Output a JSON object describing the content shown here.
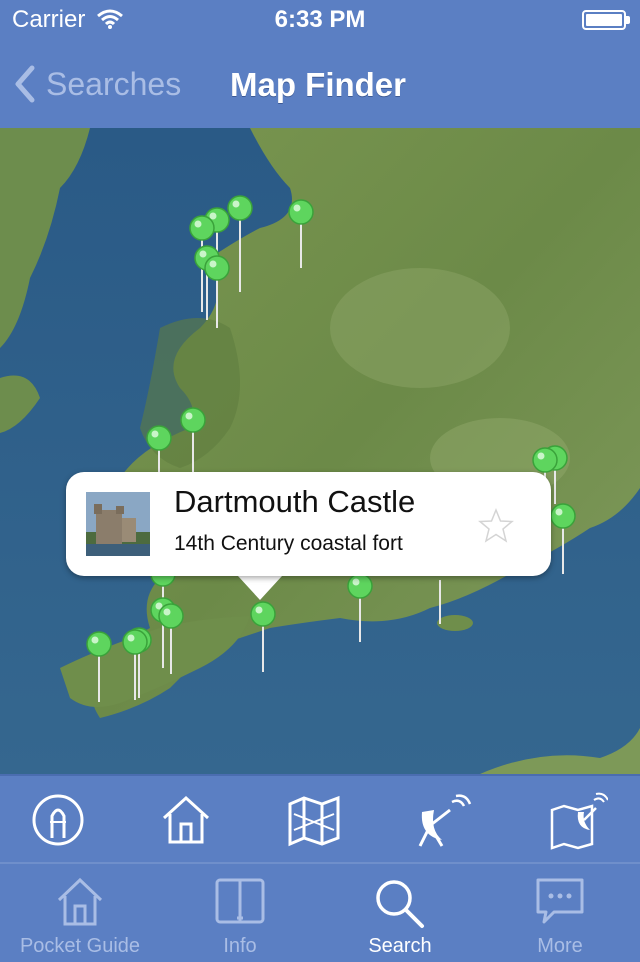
{
  "status_bar": {
    "carrier": "Carrier",
    "time": "6:33 PM"
  },
  "nav": {
    "back_label": "Searches",
    "title": "Map Finder"
  },
  "callout": {
    "title": "Dartmouth Castle",
    "subtitle": "14th Century coastal fort"
  },
  "toolbar": {
    "icons": [
      "lighthouse-icon",
      "house-icon",
      "map-icon",
      "satellite-dish-icon",
      "map-satellite-icon"
    ]
  },
  "tabs": [
    {
      "label": "Pocket Guide",
      "icon": "house-icon"
    },
    {
      "label": "Info",
      "icon": "book-icon"
    },
    {
      "label": "Search",
      "icon": "search-icon"
    },
    {
      "label": "More",
      "icon": "chat-bubble-icon"
    }
  ],
  "colors": {
    "bar": "#5b7fc3",
    "pin": "#5ed55e",
    "sea": "#2d5f89",
    "land": "#6f8e4a"
  }
}
